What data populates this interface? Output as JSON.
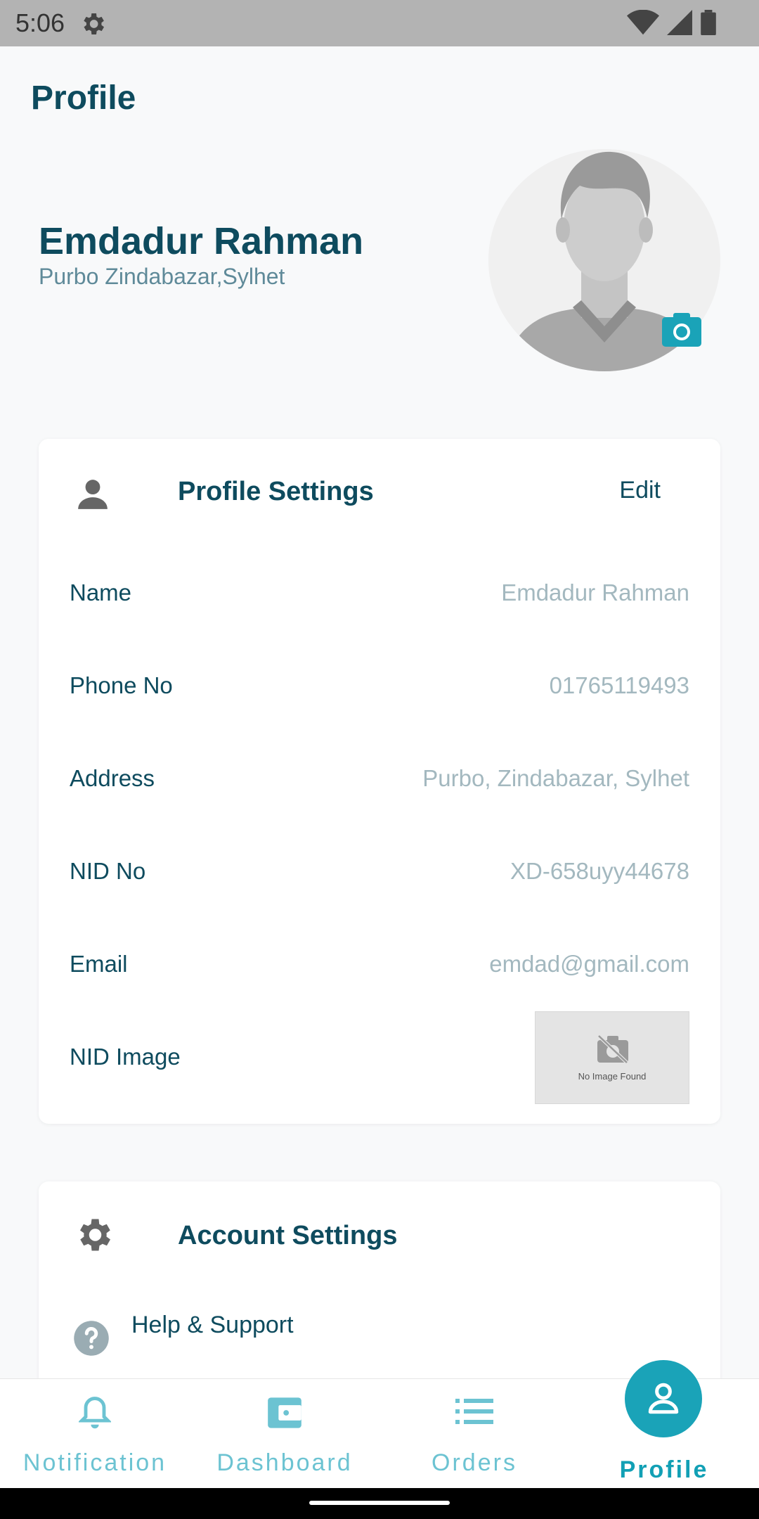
{
  "status": {
    "time": "5:06"
  },
  "header": {
    "title": "Profile"
  },
  "user": {
    "name": "Emdadur Rahman",
    "address": "Purbo Zindabazar,Sylhet"
  },
  "profile_settings": {
    "title": "Profile Settings",
    "edit_label": "Edit",
    "rows": [
      {
        "label": "Name",
        "value": "Emdadur Rahman"
      },
      {
        "label": "Phone No",
        "value": "01765119493"
      },
      {
        "label": "Address",
        "value": "Purbo, Zindabazar, Sylhet"
      },
      {
        "label": "NID No",
        "value": "XD-658uyy44678"
      },
      {
        "label": "Email",
        "value": "emdad@gmail.com"
      }
    ],
    "nid_image_label": "NID Image",
    "nid_image_placeholder": "No Image Found"
  },
  "account_settings": {
    "title": "Account Settings",
    "help_label": "Help & Support"
  },
  "bottom_nav": {
    "items": [
      {
        "label": "Notification",
        "icon": "bell-icon"
      },
      {
        "label": "Dashboard",
        "icon": "wallet-icon"
      },
      {
        "label": "Orders",
        "icon": "list-icon"
      },
      {
        "label": "Profile",
        "icon": "person-icon",
        "active": true
      }
    ]
  },
  "colors": {
    "primary": "#0e4b5e",
    "accent": "#1aa3b8",
    "value_text": "#a3b8bf",
    "background": "#f8f9fa"
  }
}
